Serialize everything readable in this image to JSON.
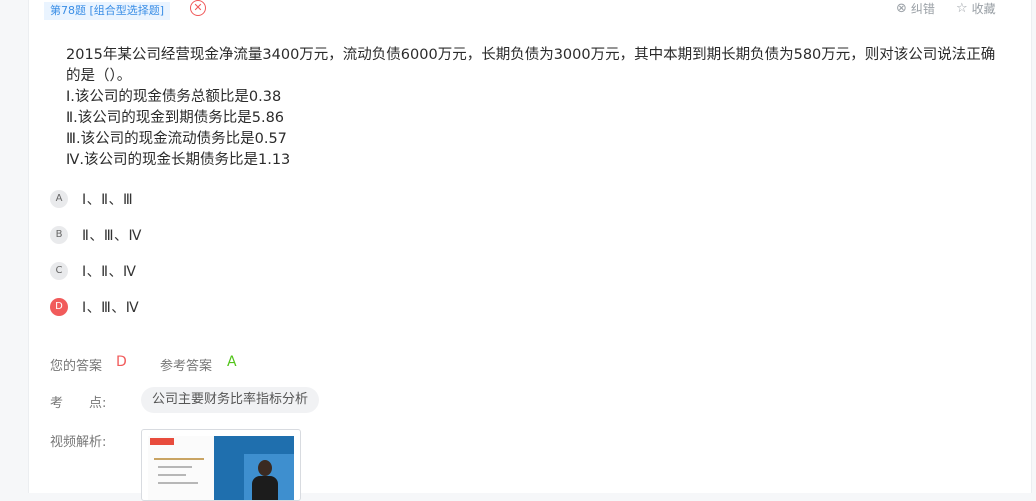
{
  "header": {
    "question_tag": "第78题 [组合型选择题]",
    "report_label": "纠错",
    "favorite_label": "收藏"
  },
  "question": {
    "stem": "2015年某公司经营现金净流量3400万元，流动负债6000万元，长期负债为3000万元，其中本期到期长期负债为580万元，则对该公司说法正确的是（）。",
    "statements": [
      "Ⅰ.该公司的现金债务总额比是0.38",
      "Ⅱ.该公司的现金到期债务比是5.86",
      "Ⅲ.该公司的现金流动债务比是0.57",
      "Ⅳ.该公司的现金长期债务比是1.13"
    ]
  },
  "options": [
    {
      "letter": "A",
      "text": "Ⅰ、Ⅱ、Ⅲ",
      "selected": false
    },
    {
      "letter": "B",
      "text": "Ⅱ、Ⅲ、Ⅳ",
      "selected": false
    },
    {
      "letter": "C",
      "text": "Ⅰ、Ⅱ、Ⅳ",
      "selected": false
    },
    {
      "letter": "D",
      "text": "Ⅰ、Ⅲ、Ⅳ",
      "selected": true
    }
  ],
  "answer": {
    "your_label": "您的答案",
    "your_value": "D",
    "ref_label": "参考答案",
    "ref_value": "A"
  },
  "knowledge": {
    "label": "考　　点:",
    "tag": "公司主要财务比率指标分析"
  },
  "video": {
    "label": "视频解析:"
  },
  "colors": {
    "wrong": "#f15b5b",
    "correct": "#52c41a",
    "tag_blue": "#3a8ee6"
  },
  "icons": {
    "wrong": "x-circle-icon",
    "report": "x-circle-icon",
    "favorite": "star-icon"
  }
}
